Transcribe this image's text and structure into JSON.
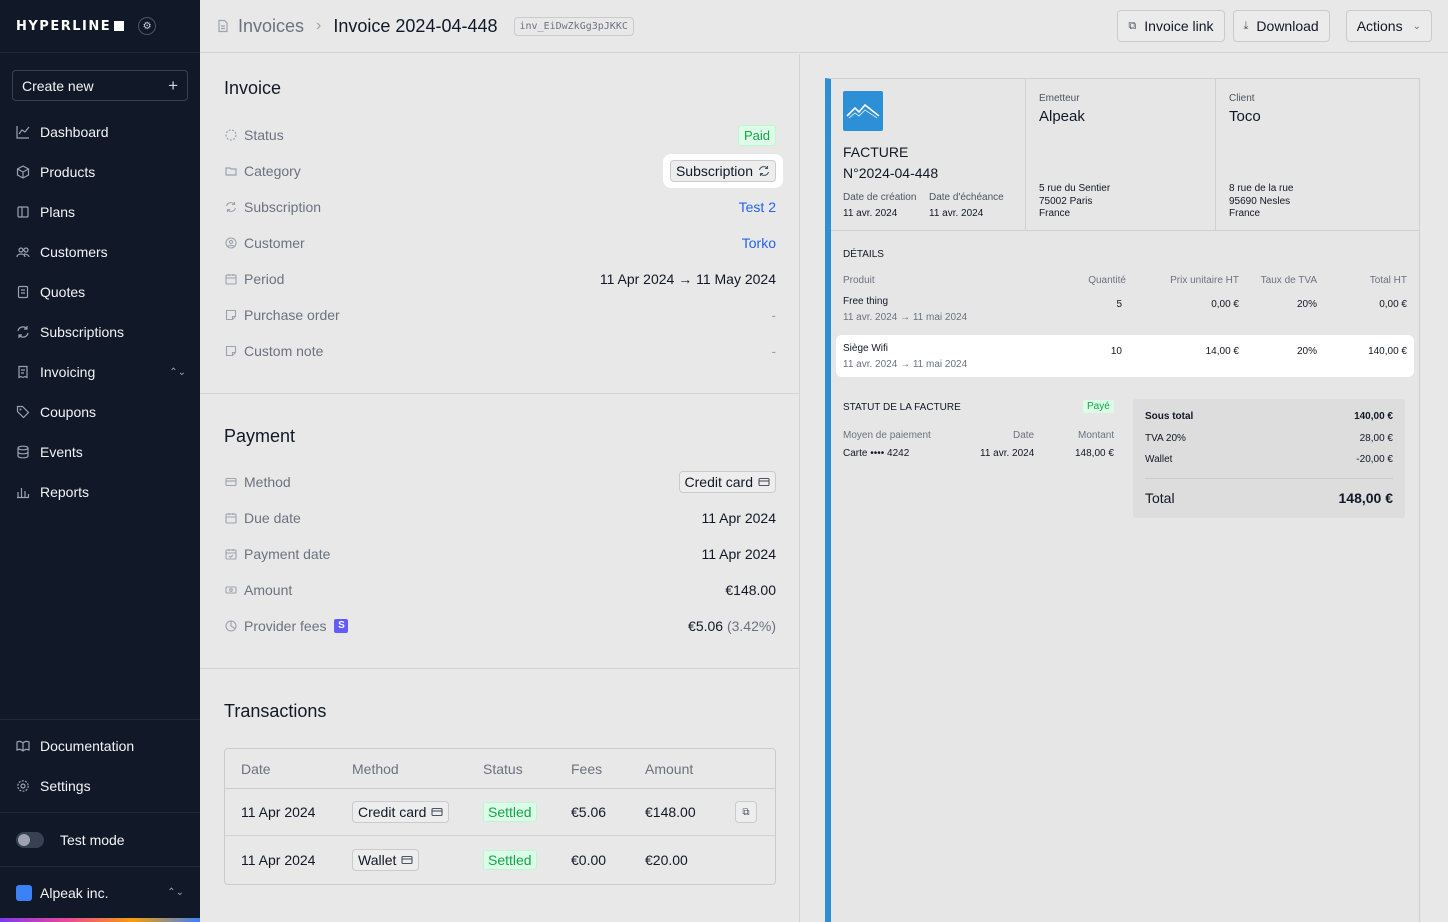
{
  "sidebar": {
    "logo": "HYPERLINE",
    "create_new": "Create new",
    "items": [
      {
        "label": "Dashboard",
        "icon": "chart-line-icon"
      },
      {
        "label": "Products",
        "icon": "box-icon"
      },
      {
        "label": "Plans",
        "icon": "book-icon"
      },
      {
        "label": "Customers",
        "icon": "users-icon"
      },
      {
        "label": "Quotes",
        "icon": "quote-doc-icon"
      },
      {
        "label": "Subscriptions",
        "icon": "refresh-icon"
      },
      {
        "label": "Invoicing",
        "icon": "invoice-icon"
      },
      {
        "label": "Coupons",
        "icon": "tag-icon"
      },
      {
        "label": "Events",
        "icon": "database-icon"
      },
      {
        "label": "Reports",
        "icon": "bar-chart-icon"
      }
    ],
    "documentation": "Documentation",
    "settings": "Settings",
    "test_mode": "Test mode",
    "org": "Alpeak inc."
  },
  "header": {
    "crumb_root": "Invoices",
    "crumb_current": "Invoice 2024-04-448",
    "invoice_id": "inv_EiDwZkGg3pJKKC",
    "invoice_link": "Invoice link",
    "download": "Download",
    "actions": "Actions"
  },
  "invoice": {
    "title": "Invoice",
    "status_label": "Status",
    "status": "Paid",
    "category_label": "Category",
    "category": "Subscription",
    "subscription_label": "Subscription",
    "subscription": "Test 2",
    "customer_label": "Customer",
    "customer": "Torko",
    "period_label": "Period",
    "period": "11 Apr 2024 → 11 May 2024",
    "po_label": "Purchase order",
    "po": "-",
    "note_label": "Custom note",
    "note": "-"
  },
  "payment": {
    "title": "Payment",
    "method_label": "Method",
    "method": "Credit card",
    "due_label": "Due date",
    "due": "11 Apr 2024",
    "paydate_label": "Payment date",
    "paydate": "11 Apr 2024",
    "amount_label": "Amount",
    "amount": "€148.00",
    "fees_label": "Provider fees",
    "stripe": "S",
    "fees": "€5.06",
    "fees_pct": "(3.42%)"
  },
  "transactions": {
    "title": "Transactions",
    "columns": [
      "Date",
      "Method",
      "Status",
      "Fees",
      "Amount"
    ],
    "rows": [
      {
        "date": "11 Apr 2024",
        "method": "Credit card",
        "status": "Settled",
        "fees": "€5.06",
        "amount": "€148.00"
      },
      {
        "date": "11 Apr 2024",
        "method": "Wallet",
        "status": "Settled",
        "fees": "€0.00",
        "amount": "€20.00"
      }
    ]
  },
  "preview": {
    "facture": "FACTURE",
    "number": "N°2024-04-448",
    "creation_label": "Date de création",
    "creation": "11 avr. 2024",
    "due_label": "Date d'échéance",
    "due": "11 avr. 2024",
    "emitter_label": "Emetteur",
    "emitter": "Alpeak",
    "emitter_addr": [
      "5 rue du Sentier",
      "75002 Paris",
      "France"
    ],
    "client_label": "Client",
    "client": "Toco",
    "client_addr": [
      "8 rue de la rue",
      "95690 Nesles",
      "France"
    ],
    "details_label": "DÉTAILS",
    "columns": [
      "Produit",
      "Quantité",
      "Prix unitaire HT",
      "Taux de TVA",
      "Total HT"
    ],
    "lines": [
      {
        "name": "Free thing",
        "period": "11 avr. 2024 → 11 mai 2024",
        "qty": "5",
        "unit": "0,00 €",
        "vat": "20%",
        "total": "0,00 €"
      },
      {
        "name": "Siège Wifi",
        "period": "11 avr. 2024 → 11 mai 2024",
        "qty": "10",
        "unit": "14,00 €",
        "vat": "20%",
        "total": "140,00 €"
      }
    ],
    "status_label": "STATUT DE LA FACTURE",
    "status": "Payé",
    "pay_method_label": "Moyen de paiement",
    "pay_method": "Carte •••• 4242",
    "pay_date_label": "Date",
    "pay_date": "11 avr. 2024",
    "pay_amount_label": "Montant",
    "pay_amount": "148,00 €",
    "subtotal_label": "Sous total",
    "subtotal": "140,00 €",
    "tva_label": "TVA 20%",
    "tva": "28,00 €",
    "wallet_label": "Wallet",
    "wallet": "-20,00 €",
    "total_label": "Total",
    "total": "148,00 €"
  },
  "colors": {
    "sidebar_bg": "#111827",
    "accent_blue": "#2563eb",
    "paid_green": "#16a34a",
    "stripe": "#635bff",
    "invoice_bar": "#2d8fd5"
  }
}
